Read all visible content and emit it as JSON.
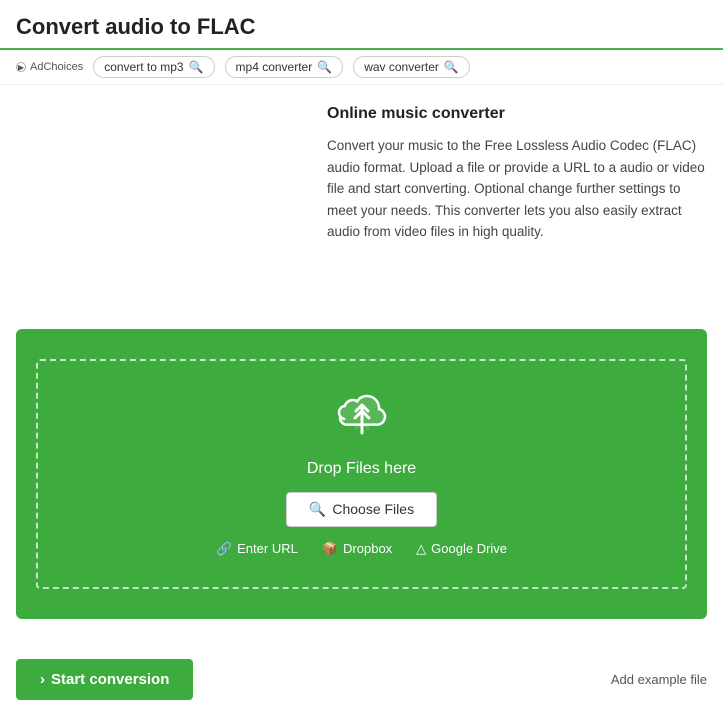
{
  "header": {
    "title": "Convert audio to FLAC"
  },
  "ad_bar": {
    "ad_choices_label": "AdChoices",
    "tags": [
      {
        "label": "convert to mp3"
      },
      {
        "label": "mp4 converter"
      },
      {
        "label": "wav converter"
      }
    ]
  },
  "description": {
    "title": "Online music converter",
    "body": "Convert your music to the Free Lossless Audio Codec (FLAC) audio format. Upload a file or provide a URL to a audio or video file and start converting. Optional change further settings to meet your needs. This converter lets you also easily extract audio from video files in high quality."
  },
  "upload_box": {
    "drop_text": "Drop Files here",
    "choose_files_label": "Choose Files",
    "enter_url_label": "Enter URL",
    "dropbox_label": "Dropbox",
    "google_drive_label": "Google Drive"
  },
  "bottom": {
    "start_conversion_label": "Start conversion",
    "add_example_label": "Add example file"
  }
}
